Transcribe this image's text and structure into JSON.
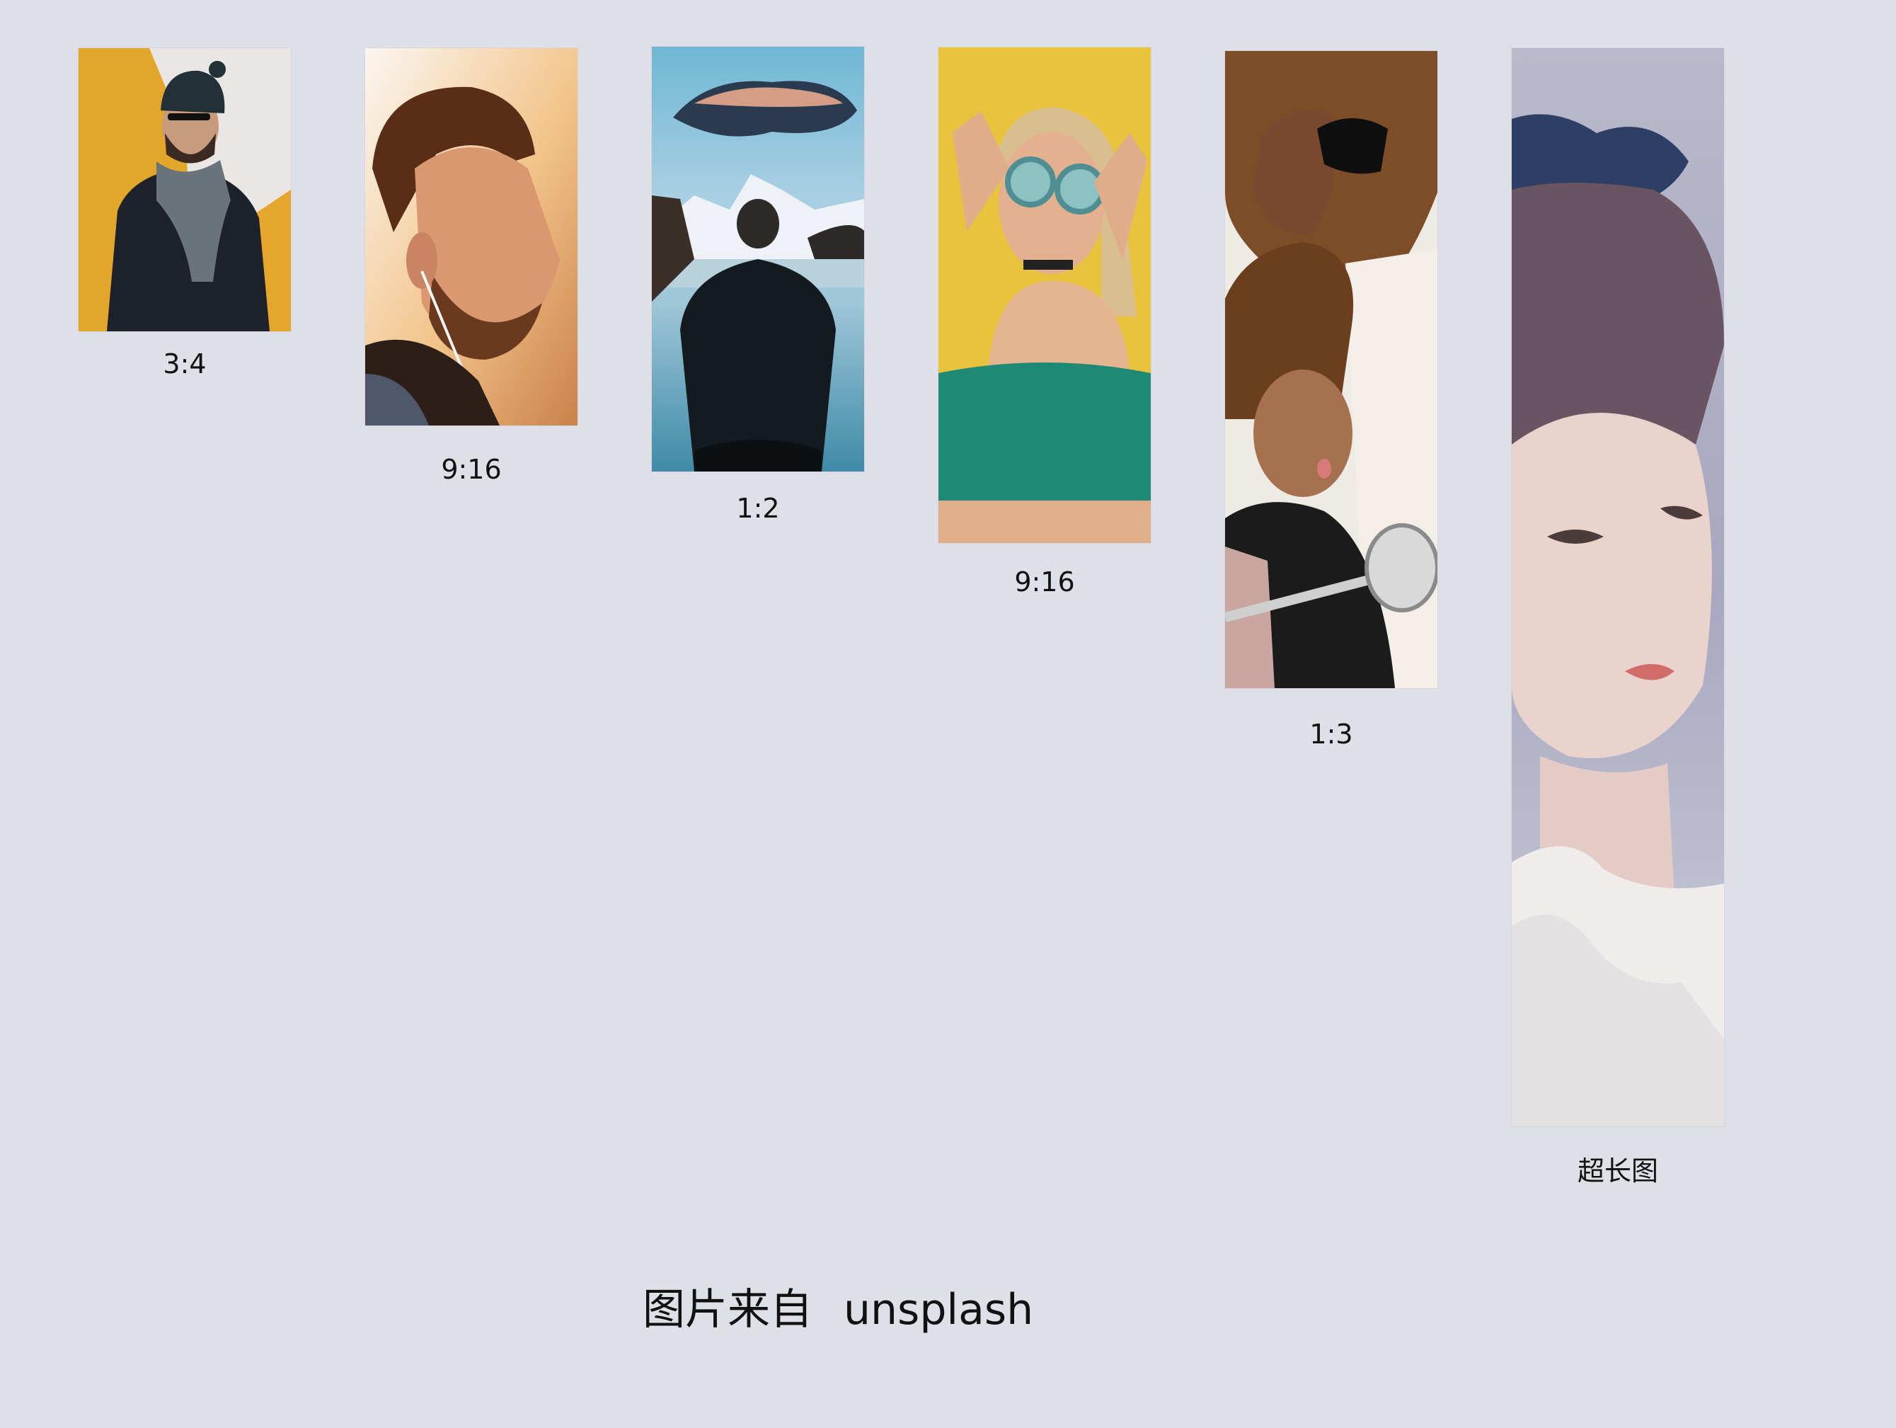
{
  "cards": [
    {
      "ratio_label": "3:4"
    },
    {
      "ratio_label": "9:16"
    },
    {
      "ratio_label": "1:2"
    },
    {
      "ratio_label": "9:16"
    },
    {
      "ratio_label": "1:3"
    },
    {
      "ratio_label": "超长图"
    }
  ],
  "footer": {
    "prefix": "图片来自",
    "source": "unsplash"
  },
  "colors": {
    "background": "#dfdfe8",
    "text": "#111111"
  }
}
